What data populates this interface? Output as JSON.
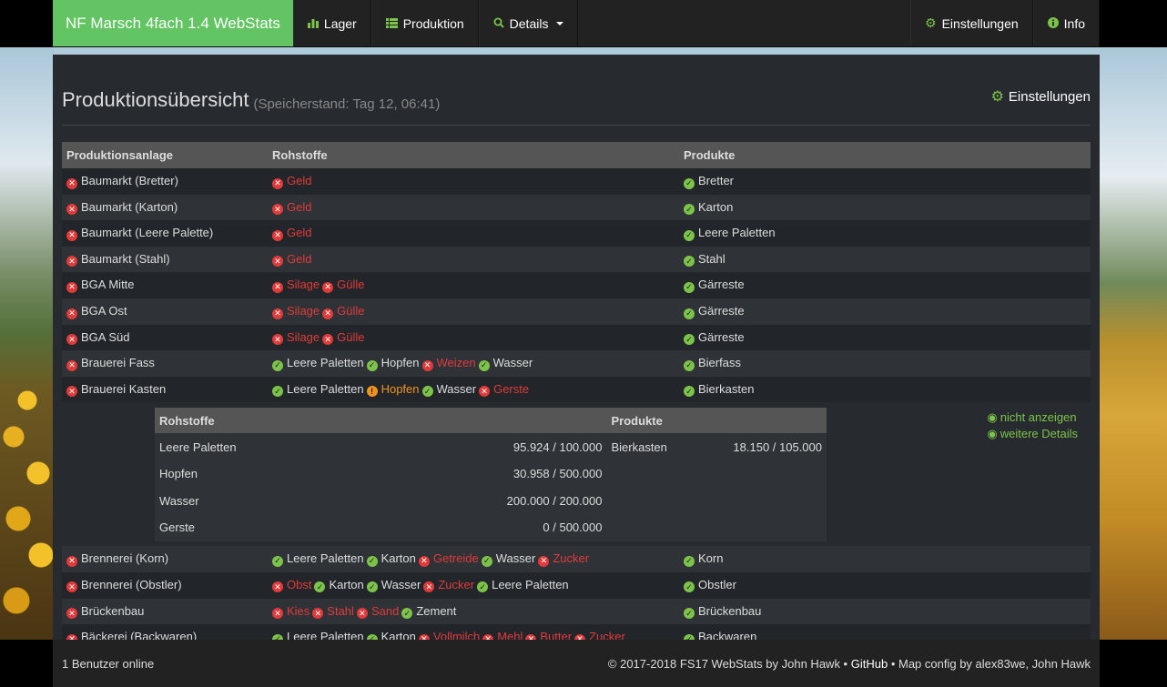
{
  "navbar": {
    "brand": "NF Marsch 4fach 1.4 WebStats",
    "items": [
      {
        "label": "Lager",
        "icon": "bar-chart-icon"
      },
      {
        "label": "Produktion",
        "icon": "list-icon"
      },
      {
        "label": "Details",
        "icon": "search-icon"
      }
    ],
    "right": [
      {
        "label": "Einstellungen",
        "icon": "gear-icon"
      },
      {
        "label": "Info",
        "icon": "info-icon"
      }
    ]
  },
  "page": {
    "title": "Produktionsübersicht",
    "savegame": "(Speicherstand: Tag 12, 06:41)",
    "settings_label": "Einstellungen"
  },
  "table": {
    "headers": [
      "Produktionsanlage",
      "Rohstoffe",
      "Produkte"
    ],
    "rows_before": [
      {
        "name": "Baumarkt (Bretter)",
        "inputs": [
          [
            "err",
            "Geld"
          ]
        ],
        "outputs": [
          [
            "ok",
            "Bretter"
          ]
        ]
      },
      {
        "name": "Baumarkt (Karton)",
        "inputs": [
          [
            "err",
            "Geld"
          ]
        ],
        "outputs": [
          [
            "ok",
            "Karton"
          ]
        ]
      },
      {
        "name": "Baumarkt (Leere Palette)",
        "inputs": [
          [
            "err",
            "Geld"
          ]
        ],
        "outputs": [
          [
            "ok",
            "Leere Paletten"
          ]
        ]
      },
      {
        "name": "Baumarkt (Stahl)",
        "inputs": [
          [
            "err",
            "Geld"
          ]
        ],
        "outputs": [
          [
            "ok",
            "Stahl"
          ]
        ]
      },
      {
        "name": "BGA Mitte",
        "inputs": [
          [
            "err",
            "Silage"
          ],
          [
            "err",
            "Gülle"
          ]
        ],
        "outputs": [
          [
            "ok",
            "Gärreste"
          ]
        ]
      },
      {
        "name": "BGA Ost",
        "inputs": [
          [
            "err",
            "Silage"
          ],
          [
            "err",
            "Gülle"
          ]
        ],
        "outputs": [
          [
            "ok",
            "Gärreste"
          ]
        ]
      },
      {
        "name": "BGA Süd",
        "inputs": [
          [
            "err",
            "Silage"
          ],
          [
            "err",
            "Gülle"
          ]
        ],
        "outputs": [
          [
            "ok",
            "Gärreste"
          ]
        ]
      },
      {
        "name": "Brauerei Fass",
        "inputs": [
          [
            "ok",
            "Leere Paletten"
          ],
          [
            "ok",
            "Hopfen"
          ],
          [
            "err",
            "Weizen"
          ],
          [
            "ok",
            "Wasser"
          ]
        ],
        "outputs": [
          [
            "ok",
            "Bierfass"
          ]
        ]
      },
      {
        "name": "Brauerei Kasten",
        "inputs": [
          [
            "ok",
            "Leere Paletten"
          ],
          [
            "warn",
            "Hopfen"
          ],
          [
            "ok",
            "Wasser"
          ],
          [
            "err",
            "Gerste"
          ]
        ],
        "outputs": [
          [
            "ok",
            "Bierkasten"
          ]
        ]
      }
    ],
    "detail": {
      "headers": [
        "Rohstoffe",
        "Produkte"
      ],
      "inputs": [
        {
          "name": "Leere Paletten",
          "value": "95.924 / 100.000"
        },
        {
          "name": "Hopfen",
          "value": "30.958 / 500.000"
        },
        {
          "name": "Wasser",
          "value": "200.000 / 200.000"
        },
        {
          "name": "Gerste",
          "value": "0 / 500.000"
        }
      ],
      "outputs": [
        {
          "name": "Bierkasten",
          "value": "18.150 / 105.000"
        }
      ],
      "hide_label": "nicht anzeigen",
      "more_label": "weitere Details"
    },
    "rows_after": [
      {
        "name": "Brennerei (Korn)",
        "inputs": [
          [
            "ok",
            "Leere Paletten"
          ],
          [
            "ok",
            "Karton"
          ],
          [
            "err",
            "Getreide"
          ],
          [
            "ok",
            "Wasser"
          ],
          [
            "err",
            "Zucker"
          ]
        ],
        "outputs": [
          [
            "ok",
            "Korn"
          ]
        ]
      },
      {
        "name": "Brennerei (Obstler)",
        "inputs": [
          [
            "err",
            "Obst"
          ],
          [
            "ok",
            "Karton"
          ],
          [
            "ok",
            "Wasser"
          ],
          [
            "err",
            "Zucker"
          ],
          [
            "ok",
            "Leere Paletten"
          ]
        ],
        "outputs": [
          [
            "ok",
            "Obstler"
          ]
        ]
      },
      {
        "name": "Brückenbau",
        "inputs": [
          [
            "err",
            "Kies"
          ],
          [
            "err",
            "Stahl"
          ],
          [
            "err",
            "Sand"
          ],
          [
            "ok",
            "Zement"
          ]
        ],
        "outputs": [
          [
            "ok",
            "Brückenbau"
          ]
        ]
      },
      {
        "name": "Bäckerei (Backwaren)",
        "inputs": [
          [
            "ok",
            "Leere Paletten"
          ],
          [
            "ok",
            "Karton"
          ],
          [
            "err",
            "Vollmilch"
          ],
          [
            "err",
            "Mehl"
          ],
          [
            "err",
            "Butter"
          ],
          [
            "err",
            "Zucker"
          ]
        ],
        "outputs": [
          [
            "ok",
            "Backwaren"
          ]
        ]
      }
    ]
  },
  "footer": {
    "users_online": "1 Benutzer online",
    "copyright": "© 2017-2018 FS17 WebStats by John Hawk •",
    "github": "GitHub",
    "map_config": "• Map config by alex83we, John Hawk"
  },
  "colors": {
    "accent": "#7cc34a",
    "brand_bg": "#62c462",
    "error": "#e03a3a",
    "warning": "#f0931e",
    "panel": "#272b2f"
  }
}
